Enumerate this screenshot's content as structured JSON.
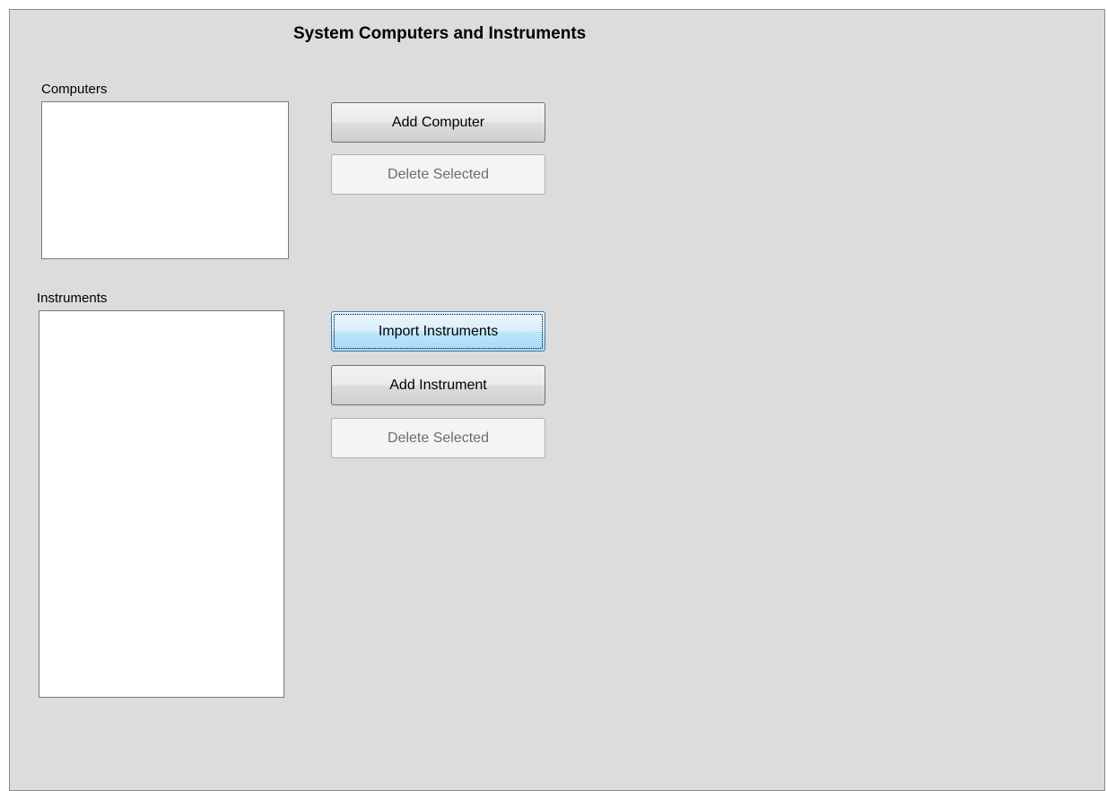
{
  "page": {
    "title": "System Computers and Instruments"
  },
  "computers": {
    "label": "Computers",
    "items": [],
    "add_button": "Add Computer",
    "delete_button": "Delete Selected"
  },
  "instruments": {
    "label": "Instruments",
    "items": [],
    "import_button": "Import Instruments",
    "add_button": "Add Instrument",
    "delete_button": "Delete Selected"
  },
  "colors": {
    "panel_background": "#dcdcdc",
    "listbox_background": "#ffffff",
    "disabled_text": "#6d6d6d"
  }
}
